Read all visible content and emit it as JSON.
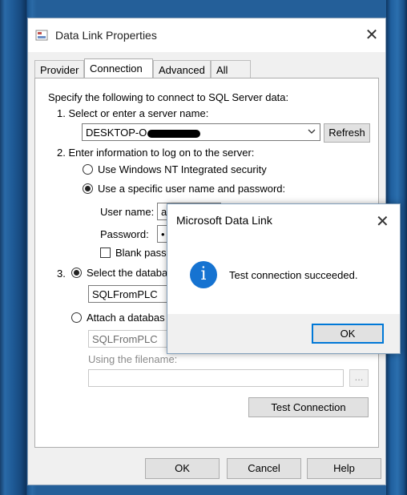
{
  "window": {
    "title": "Data Link Properties"
  },
  "tabs": [
    "Provider",
    "Connection",
    "Advanced",
    "All"
  ],
  "connection": {
    "intro": "Specify the following to connect to SQL Server data:",
    "step1": "1. Select or enter a server name:",
    "server_value": "DESKTOP-O",
    "refresh": "Refresh",
    "step2": "2. Enter information to log on to the server:",
    "radio_windows": "Use Windows NT Integrated security",
    "radio_specific": "Use a specific user name and password:",
    "username_label": "User name:",
    "username_value": "a",
    "password_label": "Password:",
    "password_value": "•",
    "blank_password": "Blank pass",
    "step3_num": "3.",
    "radio_select_db": "Select the databa",
    "database_value": "SQLFromPLC",
    "radio_attach": "Attach a databas",
    "attach_value": "SQLFromPLC",
    "filename_label": "Using the filename:",
    "browse": "...",
    "test_connection": "Test Connection"
  },
  "footer": {
    "ok": "OK",
    "cancel": "Cancel",
    "help": "Help"
  },
  "message_box": {
    "title": "Microsoft Data Link",
    "icon": "info-icon",
    "message": "Test connection succeeded.",
    "ok": "OK"
  },
  "colors": {
    "accent": "#0078d7",
    "info": "#1673d1",
    "background": "#1d4f86"
  }
}
